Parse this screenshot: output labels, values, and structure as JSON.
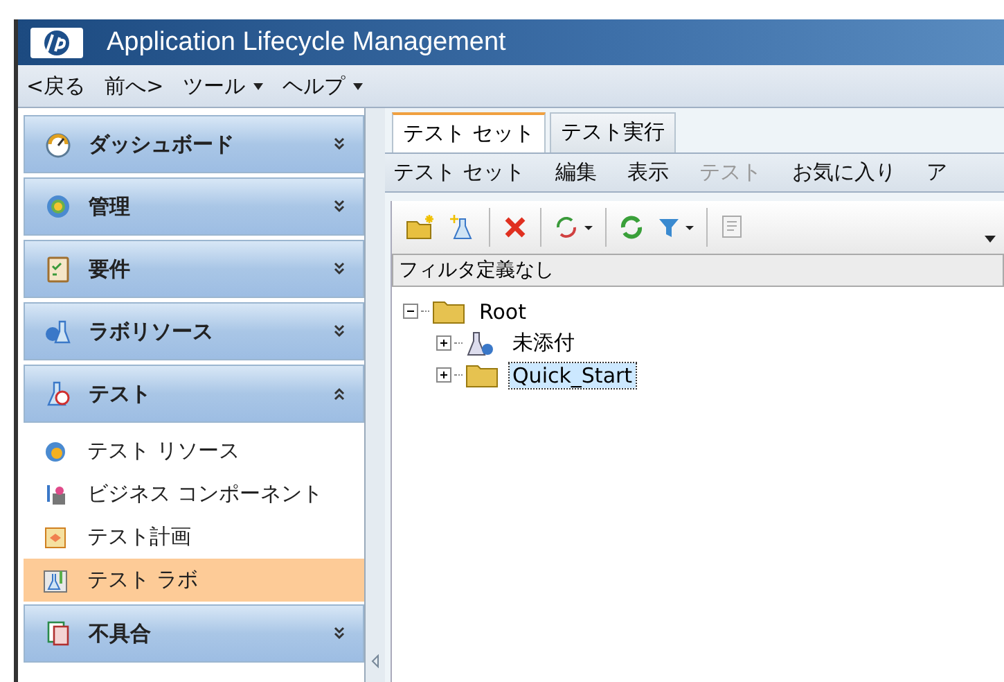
{
  "window": {
    "title": "Application Lifecycle Management"
  },
  "menu": [
    {
      "label": "<戻る",
      "dropdown": false
    },
    {
      "label": "前へ>",
      "dropdown": false
    },
    {
      "label": "ツール",
      "dropdown": true
    },
    {
      "label": "ヘルプ",
      "dropdown": true
    }
  ],
  "sidebar": {
    "modules": [
      {
        "label": "ダッシュボード",
        "expanded": false
      },
      {
        "label": "管理",
        "expanded": false
      },
      {
        "label": "要件",
        "expanded": false
      },
      {
        "label": "ラボリソース",
        "expanded": false
      },
      {
        "label": "テスト",
        "expanded": true,
        "items": [
          {
            "label": "テスト リソース",
            "selected": false
          },
          {
            "label": "ビジネス コンポーネント",
            "selected": false
          },
          {
            "label": "テスト計画",
            "selected": false
          },
          {
            "label": "テスト ラボ",
            "selected": true
          }
        ]
      },
      {
        "label": "不具合",
        "expanded": false
      }
    ]
  },
  "tabs": [
    {
      "label": "テスト セット",
      "selected": true
    },
    {
      "label": "テスト実行",
      "selected": false
    }
  ],
  "submenu": [
    {
      "label": "テスト セット",
      "disabled": false
    },
    {
      "label": "編集",
      "disabled": false
    },
    {
      "label": "表示",
      "disabled": false
    },
    {
      "label": "テスト",
      "disabled": true
    },
    {
      "label": "お気に入り",
      "disabled": false
    },
    {
      "label": "ア",
      "disabled": false
    }
  ],
  "filter": "フィルタ定義なし",
  "tree": {
    "label": "Root",
    "kind": "folder",
    "expanded": true,
    "selected": false,
    "children": [
      {
        "label": "未添付",
        "kind": "test",
        "expanded": false,
        "selected": false
      },
      {
        "label": "Quick_Start",
        "kind": "folder",
        "expanded": false,
        "selected": true
      }
    ]
  }
}
